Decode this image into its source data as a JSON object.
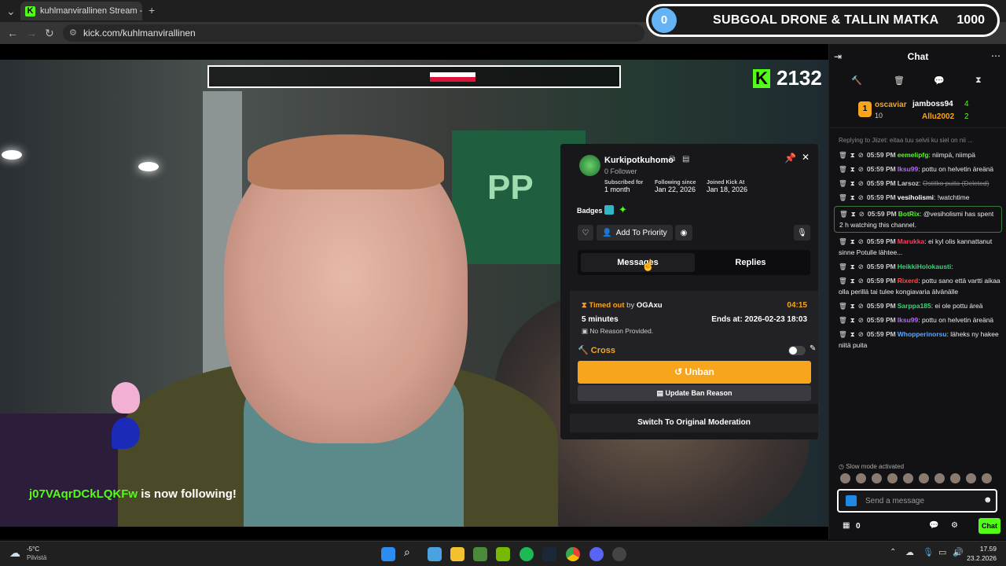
{
  "browser": {
    "tab_title": "kuhlmanvirallinen Stream -",
    "url": "kick.com/kuhlmanvirallinen"
  },
  "subgoal": {
    "current": "0",
    "title": "SUBGOAL DRONE & TALLIN MATKA",
    "target": "1000"
  },
  "video": {
    "kick_count": "2132",
    "follow_name": "j07VAqrDCkLQKFw",
    "follow_text": "is now following!"
  },
  "mod_panel": {
    "username": "Kurkipotkuhomo",
    "followers": "0 Follower",
    "stats": [
      {
        "label": "Subscribed for",
        "value": "1 month"
      },
      {
        "label": "Following since",
        "value": "Jan 22, 2026"
      },
      {
        "label": "Joined Kick At",
        "value": "Jan 18, 2026"
      }
    ],
    "badges_label": "Badges",
    "add_priority": "Add To Priority",
    "tabs": [
      "Messages",
      "Replies"
    ],
    "timeout": {
      "status": "Timed out",
      "by_prefix": "by",
      "by_user": "OGAxu",
      "remaining": "04:15",
      "duration": "5 minutes",
      "ends_at": "Ends at: 2026-02-23 18:03",
      "reason": "No Reason Provided.",
      "label": "Cross"
    },
    "unban": "Unban",
    "update_reason": "Update Ban Reason",
    "switch": "Switch To Original Moderation"
  },
  "chat": {
    "title": "Chat",
    "leaders": [
      {
        "rank": "1",
        "name": "oscaviar",
        "count": "10"
      },
      {
        "name": "jamboss94",
        "count": "4"
      },
      {
        "name": "Allu2002",
        "count": "2"
      }
    ],
    "reply_preview": "Replying to Jiizet: eitaa tuu selvii ku siel on nii ...",
    "messages": [
      {
        "time": "05:59 PM",
        "user": "eemelipfg",
        "color": "#53fc18",
        "text": "niimpä, niimpä",
        "deleted": false
      },
      {
        "time": "05:59 PM",
        "user": "Iksu99",
        "color": "#b36cf5",
        "text": "pottu on helvetin äreänä",
        "deleted": false
      },
      {
        "time": "05:59 PM",
        "user": "Larsoz",
        "color": "#cccccc",
        "text": "Ostitko puita (Deleted)",
        "deleted": true
      },
      {
        "time": "05:59 PM",
        "user": "vesiholismi",
        "color": "#ffffff",
        "text": "!watchtime",
        "deleted": false
      },
      {
        "time": "05:59 PM",
        "user": "BotRix",
        "color": "#53fc18",
        "text": "@vesiholismi has spent 2 h watching this channel.",
        "deleted": false,
        "highlight": true
      },
      {
        "time": "05:59 PM",
        "user": "Marukka",
        "color": "#ff3b5c",
        "text": "ei kyl olis kannattanut sinne Potulle lähtee...",
        "deleted": false
      },
      {
        "time": "05:59 PM",
        "user": "HeikkiHolokausti",
        "color": "#3fd17a",
        "text": "",
        "deleted": false
      },
      {
        "time": "05:59 PM",
        "user": "Rixerd",
        "color": "#ff4d4d",
        "text": "pottu sano että vartti aikaa olla perillä tai tulee kongiavaria älvänälle",
        "deleted": false
      },
      {
        "time": "05:59 PM",
        "user": "Sarppa185",
        "color": "#3fd17a",
        "text": "ei ole pottu äreä",
        "deleted": false
      },
      {
        "time": "05:59 PM",
        "user": "Iksu99",
        "color": "#b36cf5",
        "text": "pottu on helvetin äreänä",
        "deleted": false
      },
      {
        "time": "05:59 PM",
        "user": "Whopperinorsu",
        "color": "#5aa7ff",
        "text": "läheks ny hakee niitä puita",
        "deleted": false
      }
    ],
    "slow_mode": "Slow mode activated",
    "input_placeholder": "Send a message",
    "points": "0",
    "send_label": "Chat"
  },
  "taskbar": {
    "weather_temp": "-5°C",
    "weather_desc": "Pilvistä",
    "time": "17.59",
    "date": "23.2.2026"
  }
}
